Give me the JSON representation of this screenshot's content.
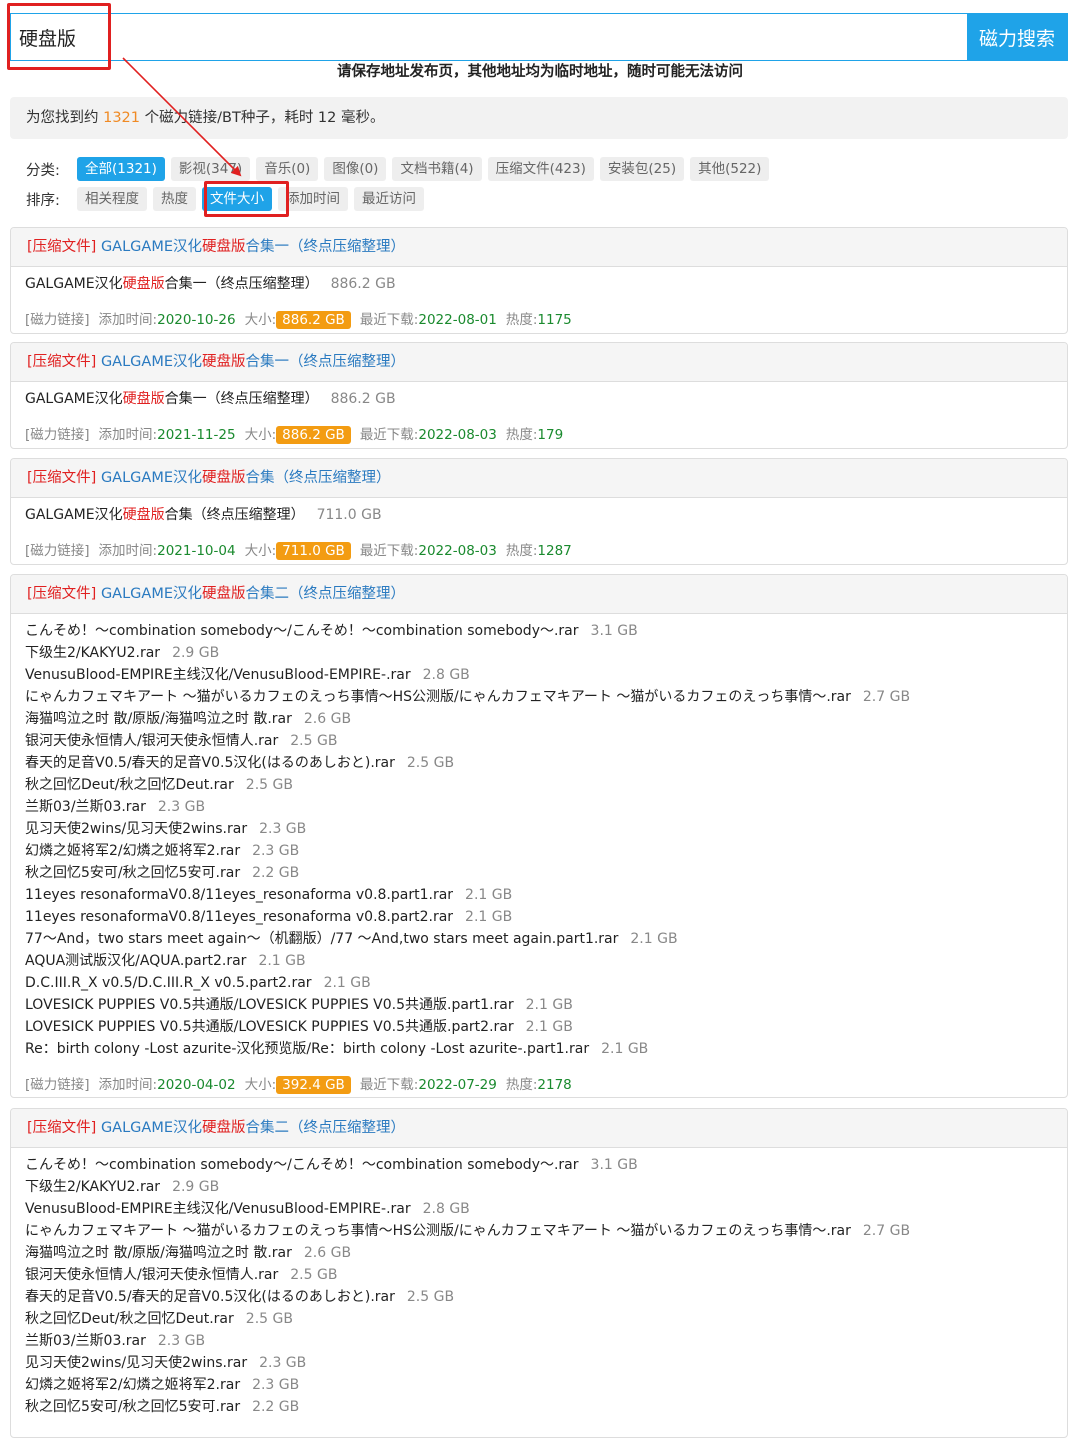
{
  "search": {
    "query": "硬盘版",
    "button_label": "磁力搜索"
  },
  "notice": "请保存地址发布页，其他地址均为临时地址，随时可能无法访问",
  "summary": {
    "prefix": "为您找到约",
    "count": "1321",
    "suffix": "个磁力链接/BT种子，耗时 12 毫秒。"
  },
  "filters": {
    "category_label": "分类:",
    "categories": [
      {
        "label": "全部(1321)",
        "active": true
      },
      {
        "label": "影视(347)",
        "active": false
      },
      {
        "label": "音乐(0)",
        "active": false
      },
      {
        "label": "图像(0)",
        "active": false
      },
      {
        "label": "文档书籍(4)",
        "active": false
      },
      {
        "label": "压缩文件(423)",
        "active": false
      },
      {
        "label": "安装包(25)",
        "active": false
      },
      {
        "label": "其他(522)",
        "active": false
      }
    ],
    "sort_label": "排序:",
    "sorts": [
      {
        "label": "相关程度",
        "active": false
      },
      {
        "label": "热度",
        "active": false
      },
      {
        "label": "文件大小",
        "active": true
      },
      {
        "label": "添加时间",
        "active": false
      },
      {
        "label": "最近访问",
        "active": false
      }
    ]
  },
  "meta_labels": {
    "magnet": "[磁力链接]",
    "added": "添加时间:",
    "size": "大小:",
    "last": "最近下载:",
    "heat": "热度:"
  },
  "colors": {
    "accent": "#1fa3e8",
    "highlight": "#e02020",
    "link": "#2a7ac0",
    "badge": "#f39c12",
    "green": "#1a8a2e",
    "annotation": "#e02020"
  },
  "annotation_arrow": {
    "color": "#e02020",
    "from": "search-box-annotation",
    "to": "sort-file-size-annotation"
  },
  "results": [
    {
      "category": "[压缩文件]",
      "title_pre": "GALGAME汉化",
      "title_hl": "硬盘版",
      "title_post": "合集一（终点压缩整理）",
      "files": [
        {
          "pre": "GALGAME汉化",
          "hl": "硬盘版",
          "post": "合集一（终点压缩整理）",
          "size": "886.2 GB"
        }
      ],
      "added": "2020-10-26",
      "size": "886.2 GB",
      "last": "2022-08-01",
      "heat": "1175"
    },
    {
      "category": "[压缩文件]",
      "title_pre": "GALGAME汉化",
      "title_hl": "硬盘版",
      "title_post": "合集一（终点压缩整理）",
      "files": [
        {
          "pre": "GALGAME汉化",
          "hl": "硬盘版",
          "post": "合集一（终点压缩整理）",
          "size": "886.2 GB"
        }
      ],
      "added": "2021-11-25",
      "size": "886.2 GB",
      "last": "2022-08-03",
      "heat": "179"
    },
    {
      "category": "[压缩文件]",
      "title_pre": "GALGAME汉化",
      "title_hl": "硬盘版",
      "title_post": "合集（终点压缩整理）",
      "files": [
        {
          "pre": "GALGAME汉化",
          "hl": "硬盘版",
          "post": "合集（终点压缩整理）",
          "size": "711.0 GB"
        }
      ],
      "added": "2021-10-04",
      "size": "711.0 GB",
      "last": "2022-08-03",
      "heat": "1287"
    },
    {
      "category": "[压缩文件]",
      "title_pre": "GALGAME汉化",
      "title_hl": "硬盘版",
      "title_post": "合集二（终点压缩整理）",
      "files": [
        {
          "pre": "こんそめ！～combination somebody～/こんそめ！～combination somebody～.rar",
          "size": "3.1 GB"
        },
        {
          "pre": "下级生2/KAKYU2.rar",
          "size": "2.9 GB"
        },
        {
          "pre": "VenusuBlood-EMPIRE主线汉化/VenusuBlood-EMPIRE-.rar",
          "size": "2.8 GB"
        },
        {
          "pre": "にゃんカフェマキアート ～猫がいるカフェのえっち事情～HS公测版/にゃんカフェマキアート ～猫がいるカフェのえっち事情～.rar",
          "size": "2.7 GB"
        },
        {
          "pre": "海猫鸣泣之时 散/原版/海猫鸣泣之时 散.rar",
          "size": "2.6 GB"
        },
        {
          "pre": "银河天使永恒情人/银河天使永恒情人.rar",
          "size": "2.5 GB"
        },
        {
          "pre": "春天的足音V0.5/春天的足音V0.5汉化(はるのあしおと).rar",
          "size": "2.5 GB"
        },
        {
          "pre": "秋之回忆Deut/秋之回忆Deut.rar",
          "size": "2.5 GB"
        },
        {
          "pre": "兰斯03/兰斯03.rar",
          "size": "2.3 GB"
        },
        {
          "pre": "见习天使2wins/见习天使2wins.rar",
          "size": "2.3 GB"
        },
        {
          "pre": "幻燐之姬将军2/幻燐之姬将军2.rar",
          "size": "2.3 GB"
        },
        {
          "pre": "秋之回忆5安可/秋之回忆5安可.rar",
          "size": "2.2 GB"
        },
        {
          "pre": "11eyes resonaformaV0.8/11eyes_resonaforma v0.8.part1.rar",
          "size": "2.1 GB"
        },
        {
          "pre": "11eyes resonaformaV0.8/11eyes_resonaforma v0.8.part2.rar",
          "size": "2.1 GB"
        },
        {
          "pre": "77～And，two stars meet again～（机翻版）/77 ～And,two stars meet again.part1.rar",
          "size": "2.1 GB"
        },
        {
          "pre": "AQUA测试版汉化/AQUA.part2.rar",
          "size": "2.1 GB"
        },
        {
          "pre": "D.C.III.R_X v0.5/D.C.III.R_X v0.5.part2.rar",
          "size": "2.1 GB"
        },
        {
          "pre": "LOVESICK PUPPIES V0.5共通版/LOVESICK PUPPIES V0.5共通版.part1.rar",
          "size": "2.1 GB"
        },
        {
          "pre": "LOVESICK PUPPIES V0.5共通版/LOVESICK PUPPIES V0.5共通版.part2.rar",
          "size": "2.1 GB"
        },
        {
          "pre": "Re：birth colony -Lost azurite-汉化预览版/Re：birth colony -Lost azurite-.part1.rar",
          "size": "2.1 GB"
        }
      ],
      "added": "2020-04-02",
      "size": "392.4 GB",
      "last": "2022-07-29",
      "heat": "2178"
    },
    {
      "category": "[压缩文件]",
      "title_pre": "GALGAME汉化",
      "title_hl": "硬盘版",
      "title_post": "合集二（终点压缩整理）",
      "files": [
        {
          "pre": "こんそめ！～combination somebody～/こんそめ！～combination somebody～.rar",
          "size": "3.1 GB"
        },
        {
          "pre": "下级生2/KAKYU2.rar",
          "size": "2.9 GB"
        },
        {
          "pre": "VenusuBlood-EMPIRE主线汉化/VenusuBlood-EMPIRE-.rar",
          "size": "2.8 GB"
        },
        {
          "pre": "にゃんカフェマキアート ～猫がいるカフェのえっち事情～HS公测版/にゃんカフェマキアート ～猫がいるカフェのえっち事情～.rar",
          "size": "2.7 GB"
        },
        {
          "pre": "海猫鸣泣之时 散/原版/海猫鸣泣之时 散.rar",
          "size": "2.6 GB"
        },
        {
          "pre": "银河天使永恒情人/银河天使永恒情人.rar",
          "size": "2.5 GB"
        },
        {
          "pre": "春天的足音V0.5/春天的足音V0.5汉化(はるのあしおと).rar",
          "size": "2.5 GB"
        },
        {
          "pre": "秋之回忆Deut/秋之回忆Deut.rar",
          "size": "2.5 GB"
        },
        {
          "pre": "兰斯03/兰斯03.rar",
          "size": "2.3 GB"
        },
        {
          "pre": "见习天使2wins/见习天使2wins.rar",
          "size": "2.3 GB"
        },
        {
          "pre": "幻燐之姬将军2/幻燐之姬将军2.rar",
          "size": "2.3 GB"
        },
        {
          "pre": "秋之回忆5安可/秋之回忆5安可.rar",
          "size": "2.2 GB"
        }
      ]
    }
  ]
}
